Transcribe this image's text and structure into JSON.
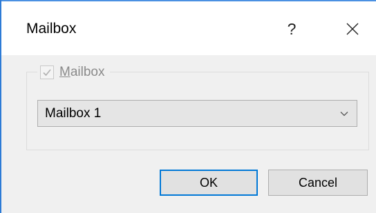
{
  "window": {
    "title": "Mailbox",
    "help_label": "?",
    "close_icon": "close-icon"
  },
  "group": {
    "checkbox_checked": true,
    "label_mnemonic": "M",
    "label_rest": "ailbox"
  },
  "combo": {
    "selected_value": "Mailbox 1",
    "arrow_icon": "chevron-down-icon"
  },
  "buttons": {
    "ok_label": "OK",
    "cancel_label": "Cancel"
  },
  "colors": {
    "accent": "#0078d7",
    "window_border": "#2d7bd6",
    "body_background": "#f0f0f0",
    "disabled_text": "#8a8a8a"
  }
}
